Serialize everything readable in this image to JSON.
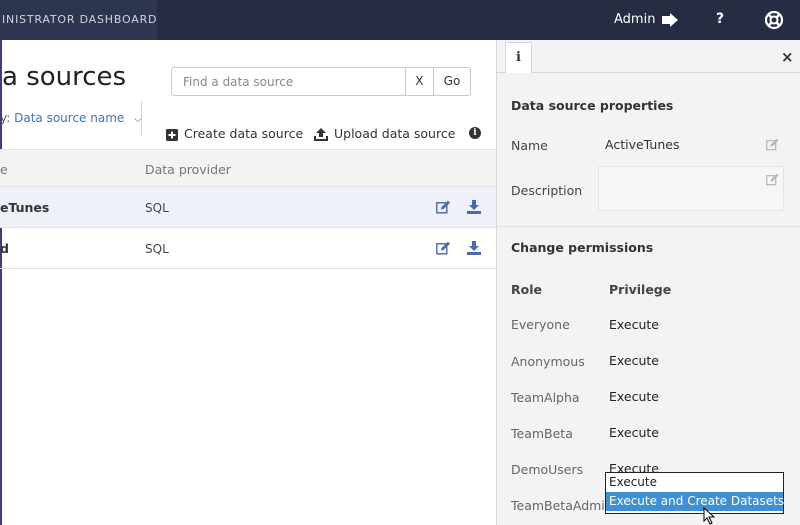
{
  "topbar": {
    "brand": "INISTRATOR DASHBOARD",
    "user": "Admin",
    "logout_icon": "sign-out-icon",
    "help": "?",
    "help_icon": "question-icon",
    "support_icon": "lifebuoy-icon"
  },
  "main": {
    "title": "a sources",
    "search": {
      "placeholder": "Find a data source",
      "clear_label": "X",
      "go_label": "Go"
    },
    "sort": {
      "prefix": "y:",
      "value": "Data source name"
    },
    "actions": {
      "create_label": "Create data source",
      "upload_label": "Upload data source"
    },
    "table": {
      "headers": [
        "e",
        "Data provider"
      ],
      "rows": [
        {
          "name": "eTunes",
          "provider": "SQL",
          "selected": true
        },
        {
          "name": "d",
          "provider": "SQL",
          "selected": false
        }
      ]
    }
  },
  "panel": {
    "tab_glyph": "i",
    "close": "×",
    "properties_title": "Data source properties",
    "name_label": "Name",
    "name_value": "ActiveTunes",
    "description_label": "Description",
    "description_value": "",
    "permissions_title": "Change permissions",
    "role_header": "Role",
    "privilege_header": "Privilege",
    "permissions": [
      {
        "role": "Everyone",
        "privilege": "Execute"
      },
      {
        "role": "Anonymous",
        "privilege": "Execute"
      },
      {
        "role": "TeamAlpha",
        "privilege": "Execute"
      },
      {
        "role": "TeamBeta",
        "privilege": "Execute"
      },
      {
        "role": "DemoUsers",
        "privilege": "Execute"
      },
      {
        "role": "TeamBetaAdmin",
        "privilege": ""
      }
    ],
    "dropdown_options": [
      "Execute",
      "Execute and Create Datasets"
    ],
    "dropdown_highlighted": "Execute and Create Datasets"
  },
  "colors": {
    "topbar": "#252c43",
    "link": "#3f73b8",
    "highlight": "#3d8fd6",
    "icon_blue": "#4b6aa8"
  }
}
